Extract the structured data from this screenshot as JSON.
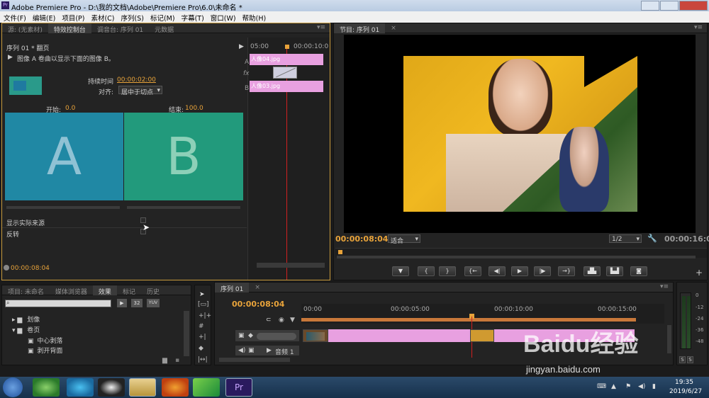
{
  "app": {
    "title": "Adobe Premiere Pro - D:\\我的文档\\Adobe\\Premiere Pro\\6.0\\未命名 *",
    "icon_label": "Pr"
  },
  "menu": [
    "文件(F)",
    "编辑(E)",
    "项目(P)",
    "素材(C)",
    "序列(S)",
    "标记(M)",
    "字幕(T)",
    "窗口(W)",
    "帮助(H)"
  ],
  "effect_controls": {
    "tabs": [
      "源: (无素材)",
      "特效控制台",
      "调音台: 序列 01",
      "元数据"
    ],
    "active_tab": 1,
    "sequence_label": "序列 01 * 翻页",
    "description": "图像 A 卷曲以显示下面的图像 B。",
    "duration_label": "持续时间",
    "duration_value": "00:00:02:00",
    "align_label": "对齐:",
    "align_value": "居中于切点",
    "start_label": "开始:",
    "start_value": "0.0",
    "end_label": "结束:",
    "end_value": "100.0",
    "preview_a": "A",
    "preview_b": "B",
    "show_source_label": "显示实际来源",
    "reverse_label": "反转",
    "timecode": "00:00:08:04",
    "mini_timeline": {
      "start_time": "05:00",
      "end_time": "00:00:10:0",
      "track_a": "A",
      "track_b": "B",
      "fx": "fx",
      "clip_a": "人像04.jpg",
      "clip_b": "人像03.jpg"
    }
  },
  "program_monitor": {
    "tab": "节目: 序列 01",
    "timecode": "00:00:08:04",
    "fit_value": "适合",
    "resolution": "1/2",
    "duration": "00:00:16:00"
  },
  "project_panel": {
    "tabs": [
      "项目: 未命名",
      "媒体浏览器",
      "效果",
      "标记",
      "历史"
    ],
    "active_tab": 2,
    "badges": [
      "32",
      "YUV"
    ],
    "tree": [
      {
        "label": "划像",
        "level": 0,
        "type": "folder"
      },
      {
        "label": "卷页",
        "level": 0,
        "type": "folder-open"
      },
      {
        "label": "中心剥落",
        "level": 1,
        "type": "effect"
      },
      {
        "label": "剥开背面",
        "level": 1,
        "type": "effect"
      }
    ]
  },
  "timeline": {
    "tab": "序列 01",
    "timecode": "00:00:08:04",
    "ruler": [
      "00:00",
      "00:00:05:00",
      "00:00:10:00",
      "00:00:15:00"
    ],
    "audio_track": "音频 1"
  },
  "audio_meter": {
    "levels": [
      "0",
      "-12",
      "-24",
      "-36",
      "-48"
    ],
    "solo": [
      "S",
      "S"
    ]
  },
  "taskbar": {
    "time": "19:35",
    "date": "2019/6/27"
  },
  "watermark": {
    "brand": "Baidu经验",
    "url": "jingyan.baidu.com"
  }
}
